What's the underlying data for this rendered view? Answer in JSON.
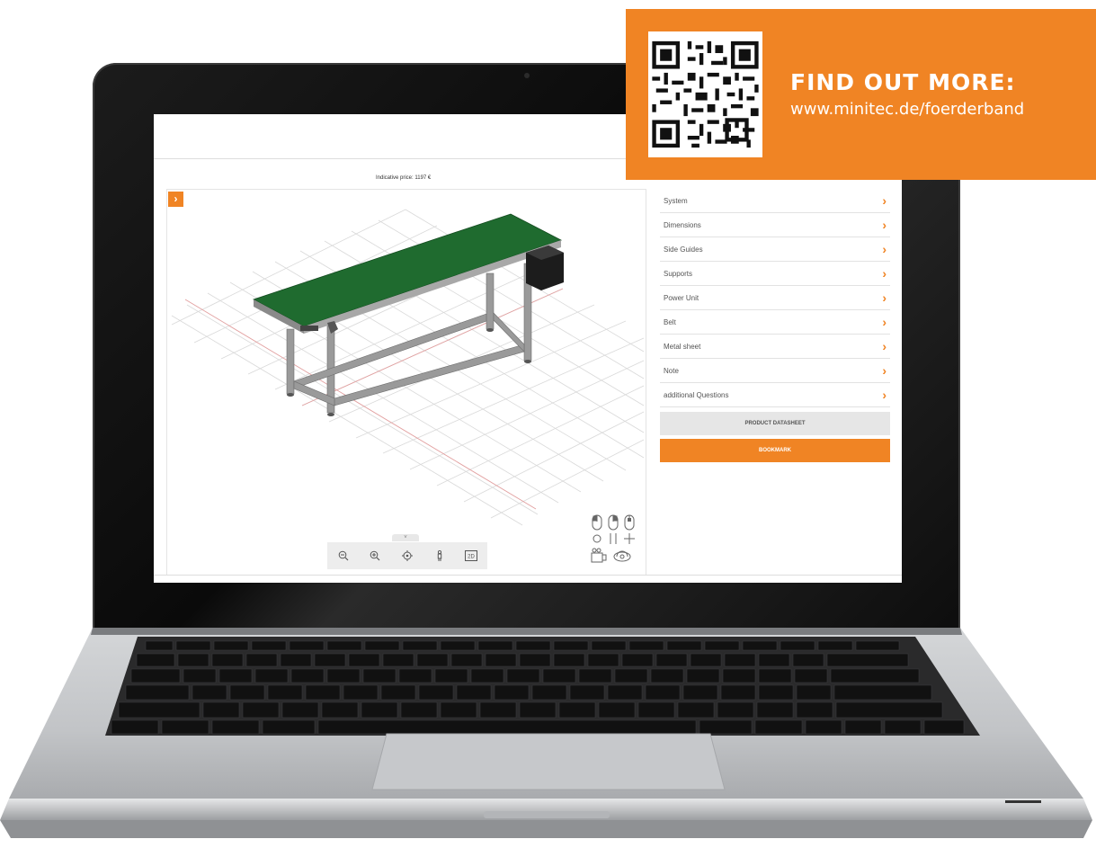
{
  "screen": {
    "indicative_price": "Indicative price: 1197 €",
    "viewer": {
      "expand_icon": "chevron-right-icon",
      "toolbar_tab_label": "˅",
      "toolbar": [
        {
          "icon": "zoom-out-icon",
          "glyph": "⊖"
        },
        {
          "icon": "zoom-in-icon",
          "glyph": "⊕"
        },
        {
          "icon": "center-view-icon",
          "glyph": "◎"
        },
        {
          "icon": "person-icon",
          "glyph": "♙"
        },
        {
          "icon": "2d-toggle-icon",
          "glyph": "2D"
        }
      ]
    },
    "menu": {
      "items": [
        {
          "label": "System"
        },
        {
          "label": "Dimensions"
        },
        {
          "label": "Side Guides"
        },
        {
          "label": "Supports"
        },
        {
          "label": "Power Unit"
        },
        {
          "label": "Belt"
        },
        {
          "label": "Metal sheet"
        },
        {
          "label": "Note"
        },
        {
          "label": "additional Questions"
        }
      ],
      "chevron": "›",
      "datasheet_label": "PRODUCT DATASHEET",
      "bookmark_label": "BOOKMARK"
    }
  },
  "banner": {
    "title": "FIND OUT MORE:",
    "url": "www.minitec.de/foerderband",
    "qr_icon": "qr-code-icon"
  },
  "colors": {
    "accent": "#f08424",
    "belt": "#1f6b2f",
    "frame": "#9a9a9a"
  }
}
